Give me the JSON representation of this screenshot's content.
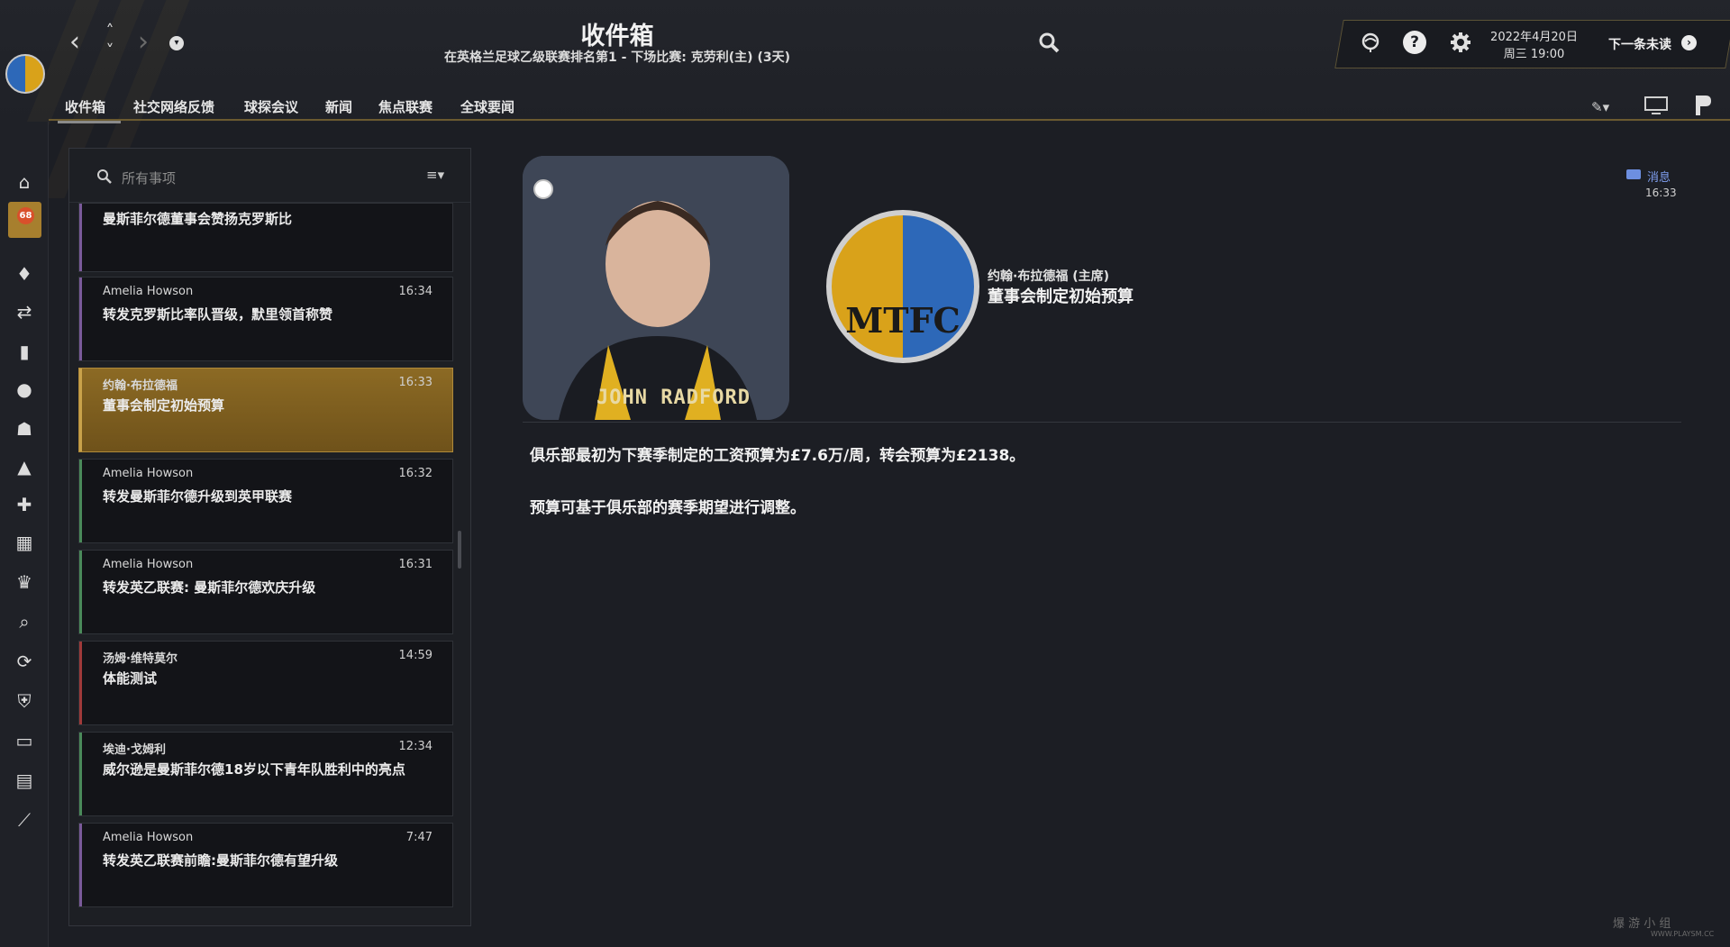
{
  "header": {
    "title": "收件箱",
    "subtitle": "在英格兰足球乙级联赛排名第1 - 下场比赛: 克劳利(主) (3天)",
    "date": "2022年4月20日",
    "day_time": "周三 19:00",
    "next_unread": "下一条未读"
  },
  "tabs": [
    "收件箱",
    "社交网络反馈",
    "球探会议",
    "新闻",
    "焦点联赛",
    "全球要闻"
  ],
  "sidebar": {
    "badge": "68",
    "icons": [
      "home-icon",
      "inbox-icon",
      "shirt-icon",
      "transfers-icon",
      "reports-icon",
      "ball-icon",
      "staff-icon",
      "training-icon",
      "medical-icon",
      "calendar-icon",
      "trophy-icon",
      "search-icon",
      "refresh-icon",
      "shield-icon",
      "briefcase-icon",
      "finance-icon",
      "stats-icon"
    ]
  },
  "search": {
    "placeholder": "所有事项"
  },
  "messages": [
    {
      "sender": "",
      "time": "",
      "subject": "曼斯菲尔德董事会赞扬克罗斯比",
      "bar_color": "#7a5a9a"
    },
    {
      "sender": "Amelia Howson",
      "time": "16:34",
      "subject": "转发克罗斯比率队晋级，默里领首称赞",
      "bar_color": "#7a5a9a"
    },
    {
      "sender": "约翰·布拉德福",
      "time": "16:33",
      "subject": "董事会制定初始预算",
      "bar_color": "#c9a24a"
    },
    {
      "sender": "Amelia Howson",
      "time": "16:32",
      "subject": "转发曼斯菲尔德升级到英甲联赛",
      "bar_color": "#4a8a5a"
    },
    {
      "sender": "Amelia Howson",
      "time": "16:31",
      "subject": "转发英乙联赛: 曼斯菲尔德欢庆升级",
      "bar_color": "#4a8a5a"
    },
    {
      "sender": "汤姆·维特莫尔",
      "time": "14:59",
      "subject": "体能测试",
      "bar_color": "#a03a3a"
    },
    {
      "sender": "埃迪·戈姆利",
      "time": "12:34",
      "subject": "威尔逊是曼斯菲尔德18岁以下青年队胜利中的亮点",
      "bar_color": "#4a8a5a"
    },
    {
      "sender": "Amelia Howson",
      "time": "7:47",
      "subject": "转发英乙联赛前瞻:曼斯菲尔德有望升级",
      "bar_color": "#7a5a9a"
    }
  ],
  "detail": {
    "portrait_label": "JOHN RADFORD",
    "crest_text": "MTFC",
    "sender_role": "约翰·布拉德福 (主席)",
    "subject": "董事会制定初始预算",
    "tag": "消息",
    "time": "16:33",
    "body": [
      "俱乐部最初为下赛季制定的工资预算为£7.6万/周，转会预算为£2138。",
      "预算可基于俱乐部的赛季期望进行调整。"
    ]
  },
  "watermark": {
    "text": "爆 游 小 组",
    "sub": "WWW.PLAYSM.CC"
  },
  "colors": {
    "accent": "#a77f2e",
    "background": "#1c1e24",
    "tag": "#7f9ff0"
  }
}
